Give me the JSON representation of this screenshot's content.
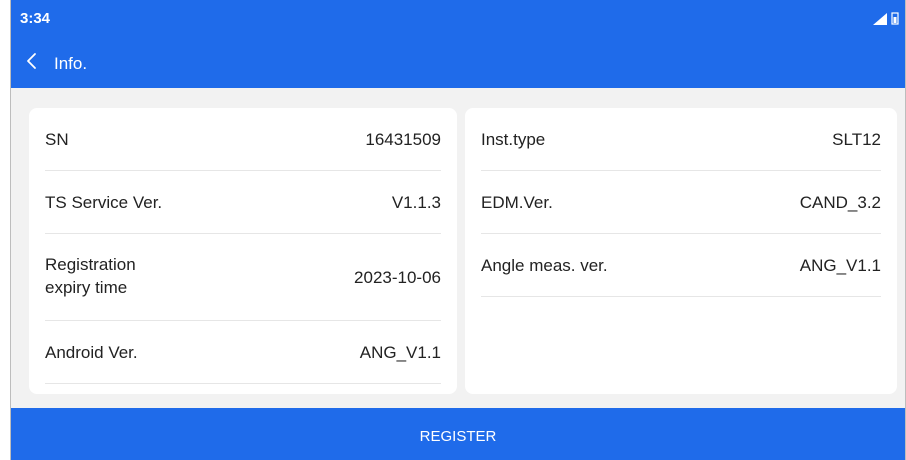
{
  "status_bar": {
    "time": "3:34",
    "icons": [
      "signal-icon",
      "battery-icon"
    ]
  },
  "app_bar": {
    "title": "Info.",
    "back_icon": "chevron-left-icon"
  },
  "left_card": {
    "rows": [
      {
        "label": "SN",
        "value": "16431509"
      },
      {
        "label": "TS Service Ver.",
        "value": "V1.1.3"
      },
      {
        "label": "Registration\nexpiry time",
        "value": "2023-10-06"
      },
      {
        "label": "Android Ver.",
        "value": "ANG_V1.1"
      }
    ]
  },
  "right_card": {
    "rows": [
      {
        "label": "Inst.type",
        "value": "SLT12"
      },
      {
        "label": "EDM.Ver.",
        "value": "CAND_3.2"
      },
      {
        "label": "Angle meas. ver.",
        "value": "ANG_V1.1"
      }
    ]
  },
  "footer": {
    "register_label": "REGISTER"
  },
  "colors": {
    "primary": "#1f6bea",
    "background": "#f2f2f2",
    "card": "#ffffff",
    "text": "#222222"
  }
}
